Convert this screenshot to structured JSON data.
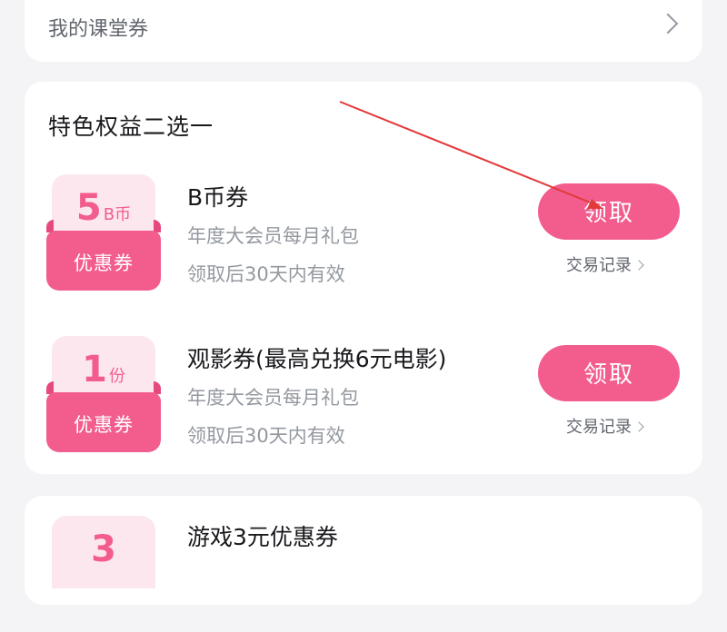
{
  "classroom": {
    "label": "我的课堂券"
  },
  "benefits": {
    "title": "特色权益二选一",
    "claim_label": "领取",
    "record_label": "交易记录",
    "coupons": [
      {
        "badge_number": "5",
        "badge_unit": "B币",
        "badge_label": "优惠券",
        "title": "B币券",
        "subtitle": "年度大会员每月礼包",
        "validity": "领取后30天内有效"
      },
      {
        "badge_number": "1",
        "badge_unit": "份",
        "badge_label": "优惠券",
        "title": "观影券(最高兑换6元电影)",
        "subtitle": "年度大会员每月礼包",
        "validity": "领取后30天内有效"
      }
    ]
  },
  "game": {
    "badge_number": "3",
    "title": "游戏3元优惠券"
  },
  "colors": {
    "accent": "#f25d8e",
    "badge_bg": "#fde7ee",
    "arrow": "#e23a3a"
  },
  "icons": [
    "chevron-right-icon"
  ]
}
